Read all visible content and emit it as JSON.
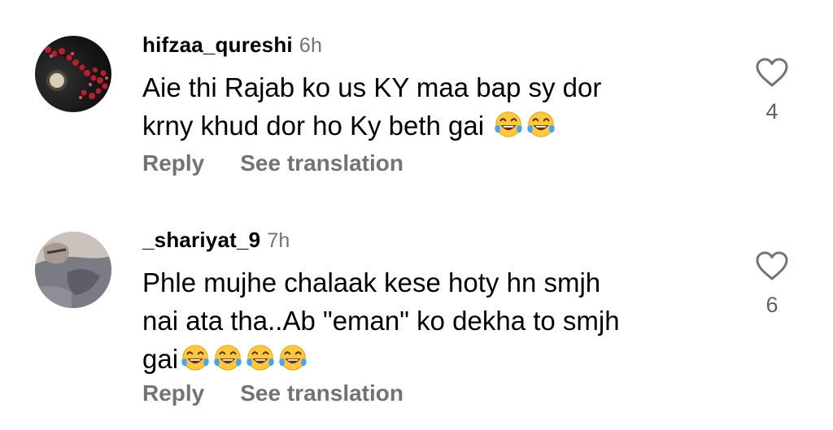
{
  "comments": [
    {
      "username": "hifzaa_qureshi",
      "time": "6h",
      "text_lines": [
        "Aie thi Rajab ko us KY maa bap sy dor",
        "krny khud dor ho Ky beth gai"
      ],
      "emojis": [
        "laughing-tears",
        "laughing-tears"
      ],
      "reply_label": "Reply",
      "translate_label": "See translation",
      "likes": "4"
    },
    {
      "username": "_shariyat_9",
      "time": "7h",
      "text_lines": [
        "Phle mujhe chalaak kese hoty hn smjh",
        "nai ata tha..Ab \"eman\" ko dekha to smjh",
        "gai"
      ],
      "emojis": [
        "laughing-tears",
        "laughing-tears",
        "laughing-tears",
        "laughing-tears"
      ],
      "reply_label": "Reply",
      "translate_label": "See translation",
      "likes": "6"
    }
  ],
  "colors": {
    "text": "#000000",
    "secondary": "#737373",
    "emoji_face": "#FFC83D",
    "emoji_tears": "#42A5F5"
  }
}
